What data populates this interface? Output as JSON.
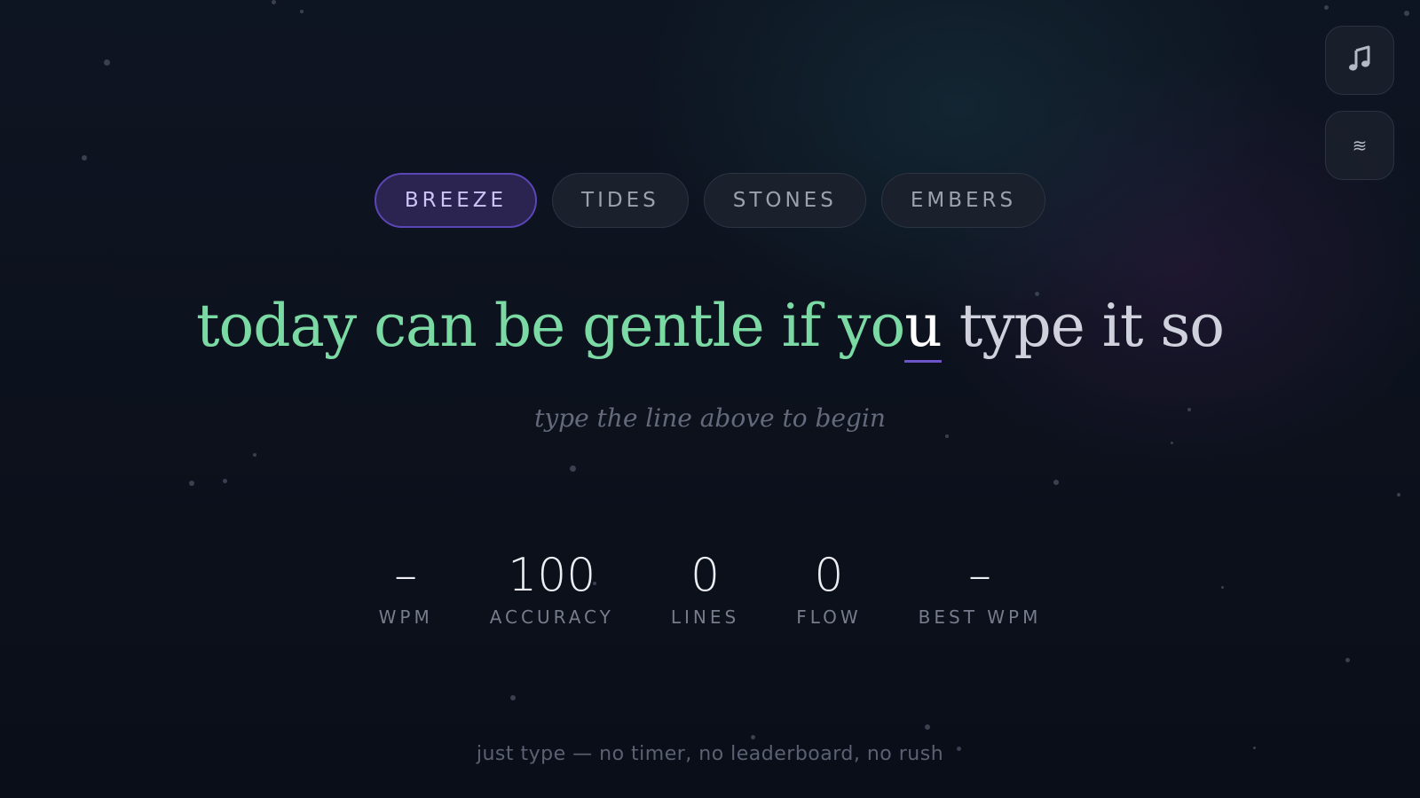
{
  "controls": {
    "music_icon": "music-note-icon",
    "waves_glyph": "≋"
  },
  "tabs": [
    {
      "label": "BREEZE",
      "active": true
    },
    {
      "label": "TIDES",
      "active": false
    },
    {
      "label": "STONES",
      "active": false
    },
    {
      "label": "EMBERS",
      "active": false
    }
  ],
  "sentence": {
    "typed": "today can be gentle if yo",
    "current": "u",
    "remaining": " type it so"
  },
  "hint": "type the line above to begin",
  "stats": [
    {
      "value": "–",
      "label": "WPM"
    },
    {
      "value": "100",
      "label": "ACCURACY"
    },
    {
      "value": "0",
      "label": "LINES"
    },
    {
      "value": "0",
      "label": "FLOW"
    },
    {
      "value": "–",
      "label": "BEST WPM"
    }
  ],
  "footer": "just type — no timer, no leaderboard, no rush",
  "colors": {
    "accent": "#6d55c9",
    "typed": "#7bd9a4",
    "background": "#0c111c"
  }
}
